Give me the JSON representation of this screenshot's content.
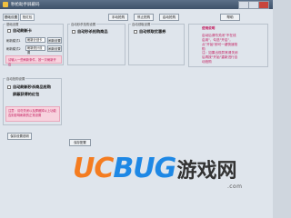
{
  "window": {
    "title": "秒抢助手屏蔽码",
    "minimize": "_",
    "maximize": "□",
    "close": "×"
  },
  "tabs": [
    {
      "label": "基础设置"
    },
    {
      "label": "抢红包"
    }
  ],
  "toolbar": [
    {
      "label": "手动抢购"
    },
    {
      "label": "停止抢购"
    },
    {
      "label": "启动抢购"
    },
    {
      "label": "帮助"
    }
  ],
  "group_left_top": {
    "title": "基础设置",
    "checkbox_label": "自动刷新卡",
    "row1_label": "刷新模式1",
    "row1_value": "刷新计划卡",
    "row1_button": "刷新设置",
    "row2_label": "刷新模式2",
    "row2_value": "刷新统计设置",
    "row2_button": "刷新设置",
    "notice": "请输入一些刷新条件，按一次刷新开启"
  },
  "group_mid": {
    "title": "自动秒杀抢购设置",
    "checkbox_label": "自动秒杀抢购商品"
  },
  "group_right": {
    "title": "自动领取设置",
    "checkbox_label": "自动领取优惠券"
  },
  "help_panel": {
    "title": "使用说明",
    "para1": "启动后请勿关闭\"不在线启用\"，勾选\"开启\"，点\"开始\"即可一键快速抢购",
    "para2": "注：如果出现异常请关闭后再按\"开始\"重新进行自动抢购"
  },
  "group_left_bottom": {
    "title": "自动抢购设置",
    "checkbox1_label": "自动刷新秒杀商品抢购",
    "checkbox2_label": "屏蔽获得的红包",
    "notice": "注意：请勿关闭以及屏蔽掉以上功能否则影响刷新的正常设置"
  },
  "save_button": "保存设置说明",
  "bottom_button": "保存配置",
  "watermark": {
    "brand_uc": "UC",
    "brand_bug": "BUG",
    "brand_cn": "游戏网",
    "url": ".com"
  }
}
